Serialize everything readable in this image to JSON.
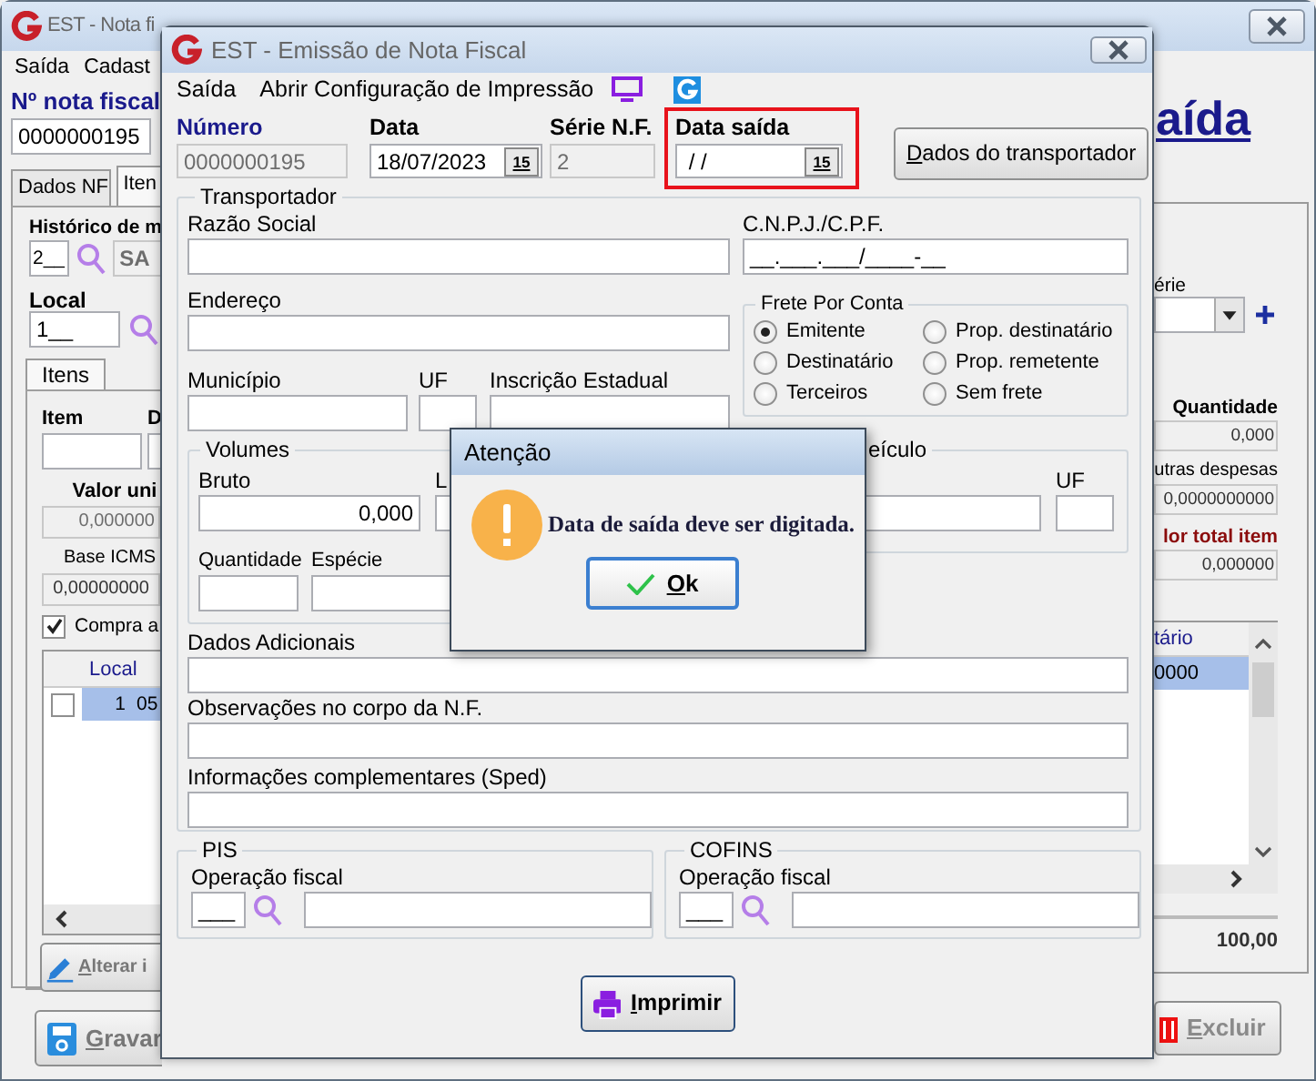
{
  "back_window": {
    "title": "EST - Nota fi",
    "menu": [
      "Saída",
      "Cadast"
    ],
    "number_label": "Nº nota fiscal",
    "number_value": "0000000195",
    "heading": "aída",
    "tabs": [
      {
        "label": "Dados NF",
        "selected": false
      },
      {
        "label": "Iten",
        "selected": true
      }
    ],
    "history": {
      "label": "Histórico de m",
      "code": "2__",
      "description": "SA"
    },
    "location": {
      "label": "Local",
      "code": "1__"
    },
    "item_tabs": [
      {
        "label": "Itens",
        "selected": true
      }
    ],
    "item_fields": [
      {
        "label": "Item"
      },
      {
        "label": "D"
      }
    ],
    "unit_value": {
      "label": "Valor uni",
      "value": "0,000000"
    },
    "icms_base": {
      "label": "Base ICMS",
      "value": "0,00000000"
    },
    "purchase_option": {
      "label": "Compra a",
      "checked": true
    },
    "items_table": {
      "columns": [
        "Local"
      ],
      "rows": [
        {
          "selected": true,
          "checked": false,
          "cells": [
            "1",
            "05"
          ]
        }
      ]
    },
    "edit_button": "Alterar i",
    "save_button": "Gravar",
    "serie_label": "érie",
    "quantity": {
      "label": "Quantidade",
      "value": "0,000"
    },
    "other_expenses": {
      "label": "utras despesas",
      "value": "0,0000000000"
    },
    "item_total": {
      "label": "lor total item",
      "value": "0,000000"
    },
    "right_table": {
      "columns": [
        "tário"
      ],
      "rows": [
        {
          "selected": true,
          "cells": [
            "0000"
          ]
        }
      ]
    },
    "total": "100,00",
    "delete_button": {
      "label": "Excluir",
      "disabled": true
    }
  },
  "dialog": {
    "title": "EST - Emissão de Nota Fiscal",
    "menu": [
      "Saída",
      "Abrir Configuração de Impressão"
    ],
    "header_fields": [
      {
        "label": "Número",
        "value": "0000000195",
        "disabled": true
      },
      {
        "label": "Data",
        "value": "18/07/2023",
        "calendar": "15",
        "disabled": false
      },
      {
        "label": "Série N.F.",
        "value": "2",
        "disabled": true
      },
      {
        "label": "Data saída",
        "value": " / /",
        "calendar": "15",
        "disabled": false,
        "highlighted": true
      }
    ],
    "carrier_button": "Dados do transportador",
    "carrier": {
      "legend": "Transportador",
      "name_label": "Razão Social",
      "tax_id_label": "C.N.P.J./C.P.F.",
      "tax_id_value": "__.___.___/____-__",
      "address_label": "Endereço",
      "city_label": "Município",
      "state_label": "UF",
      "registration_label": "Inscrição Estadual"
    },
    "freight": {
      "legend": "Frete Por Conta",
      "options": [
        {
          "label": "Emitente",
          "selected": true
        },
        {
          "label": "Prop. destinatário",
          "selected": false
        },
        {
          "label": "Destinatário",
          "selected": false
        },
        {
          "label": "Prop. remetente",
          "selected": false
        },
        {
          "label": "Terceiros",
          "selected": false
        },
        {
          "label": "Sem frete",
          "selected": false
        }
      ]
    },
    "volumes": {
      "legend": "Volumes",
      "gross_label": "Bruto",
      "gross_value": "0,000",
      "net_label": "L",
      "quantity_label": "Quantidade",
      "species_label": "Espécie"
    },
    "vehicle": {
      "legend": "eículo",
      "state_label": "UF"
    },
    "notes": [
      {
        "label": "Dados Adicionais"
      },
      {
        "label": "Observações no corpo da N.F."
      },
      {
        "label": "Informações complementares (Sped)"
      }
    ],
    "taxes": [
      {
        "legend": "PIS",
        "label": "Operação fiscal",
        "code": "___"
      },
      {
        "legend": "COFINS",
        "label": "Operação fiscal",
        "code": "___"
      }
    ],
    "print_button": "Imprimir"
  },
  "alert": {
    "title": "Atenção",
    "message": "Data de saída deve ser digitada.",
    "button": "Ok"
  }
}
